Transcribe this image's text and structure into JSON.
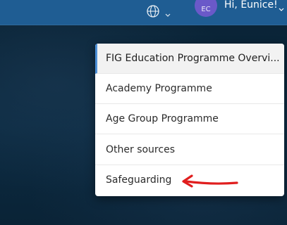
{
  "header": {
    "language_icon": "globe-icon",
    "language_chevron": "chevron-down-icon",
    "avatar_initials": "EC",
    "greeting": "Hi, Eunice!",
    "user_chevron": "chevron-down-icon"
  },
  "dropdown": {
    "items": [
      {
        "label": "FIG Education Programme Overvi..."
      },
      {
        "label": "Academy Programme"
      },
      {
        "label": "Age Group Programme"
      },
      {
        "label": "Other sources"
      },
      {
        "label": "Safeguarding"
      }
    ],
    "active_index": 0
  },
  "annotation": {
    "arrow_icon": "arrow-left-icon",
    "color": "#e01e1e"
  },
  "colors": {
    "header_bg": "#1f5d93",
    "page_bg": "#0b2a43",
    "avatar_bg": "#6a59c9",
    "active_indicator": "#4c8fd6"
  }
}
